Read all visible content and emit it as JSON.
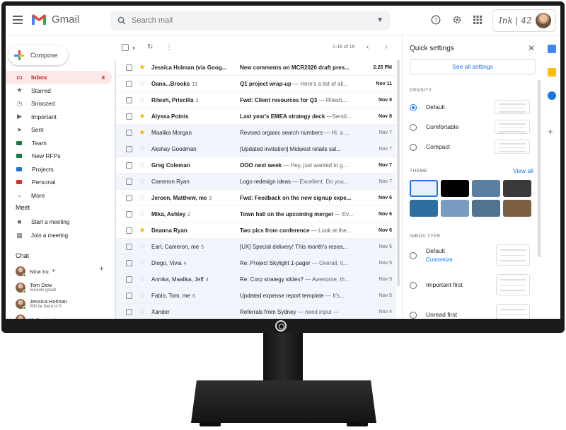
{
  "colors": {
    "accent_blue": "#1a73e8",
    "inbox_red": "#c5221f",
    "star_gold": "#f4b400",
    "bezel": "#1b1b1b"
  },
  "header": {
    "app_name": "Gmail",
    "search_placeholder": "Search mail",
    "account_brand": "Ink | 42",
    "icons": [
      "help-icon",
      "gear-icon",
      "apps-grid-icon"
    ]
  },
  "sidebar": {
    "compose_label": "Compose",
    "items": [
      {
        "label": "Inbox",
        "count": "8",
        "icon": "inbox-icon",
        "glyph": "▭",
        "active": true
      },
      {
        "label": "Starred",
        "count": "",
        "icon": "star-icon",
        "glyph": "★"
      },
      {
        "label": "Snoozed",
        "count": "",
        "icon": "clock-icon",
        "glyph": "◷"
      },
      {
        "label": "Important",
        "count": "",
        "icon": "important-icon",
        "glyph": "▶"
      },
      {
        "label": "Sent",
        "count": "",
        "icon": "send-icon",
        "glyph": "➤"
      },
      {
        "label": "Team",
        "count": "",
        "label_color": "#0b8043"
      },
      {
        "label": "New RFPs",
        "count": "",
        "label_color": "#0b8043"
      },
      {
        "label": "Projects",
        "count": "",
        "label_color": "#1a73e8"
      },
      {
        "label": "Personal",
        "count": "",
        "label_color": "#d93025"
      },
      {
        "label": "More",
        "count": "",
        "icon": "chevron-down-icon",
        "glyph": "⌄"
      }
    ],
    "meet_title": "Meet",
    "meet_items": [
      {
        "label": "Start a meeting",
        "icon": "video-icon",
        "glyph": "■"
      },
      {
        "label": "Join a meeting",
        "icon": "keyboard-icon",
        "glyph": "▦"
      }
    ],
    "chat_title": "Chat",
    "chat_self": "Nina Xu",
    "chat_users": [
      {
        "name": "Tom Dow",
        "status": "Sounds great!"
      },
      {
        "name": "Jessica Holman",
        "status": "Will be there in 5"
      },
      {
        "name": "Katherine Leaver",
        "status": ""
      }
    ]
  },
  "toolbar": {
    "pager": "1-16 of 16"
  },
  "emails": [
    {
      "sender": "Jessica Holman (via Goog...",
      "count": "",
      "subject": "New comments on MCR2020 draft pres...",
      "snippet": "",
      "date": "2:25 PM",
      "starred": true,
      "unread": true
    },
    {
      "sender": "Oana...Brooks",
      "count": "13",
      "subject": "Q1 project wrap-up",
      "snippet": " — Here's a list of all...",
      "date": "Nov 11",
      "starred": false,
      "unread": true
    },
    {
      "sender": "Ritesh, Priscilla",
      "count": "2",
      "subject": "Fwd: Client resources for Q3",
      "snippet": " — Ritesh,...",
      "date": "Nov 8",
      "starred": false,
      "unread": true
    },
    {
      "sender": "Alyssa Potnis",
      "count": "",
      "subject": "Last year's EMEA strategy deck",
      "snippet": " —Sendi...",
      "date": "Nov 8",
      "starred": true,
      "unread": true
    },
    {
      "sender": "Maalika Morgan",
      "count": "",
      "subject": "Revised organic search numbers",
      "snippet": " — Hi, a ...",
      "date": "Nov 7",
      "starred": true,
      "unread": false
    },
    {
      "sender": "Akshay Goodman",
      "count": "",
      "subject": "[Updated invitation] Midwest retails sal...",
      "snippet": "",
      "date": "Nov 7",
      "starred": false,
      "unread": false
    },
    {
      "sender": "Greg Coleman",
      "count": "",
      "subject": "OOO next week",
      "snippet": " — Hey, just wanted to g...",
      "date": "Nov 7",
      "starred": false,
      "unread": true
    },
    {
      "sender": "Cameron Ryan",
      "count": "",
      "subject": "Logo redesign ideas",
      "snippet": " — Excellent. Do you...",
      "date": "Nov 7",
      "starred": false,
      "unread": false
    },
    {
      "sender": "Jeroen, Matthew, me",
      "count": "3",
      "subject": "Fwd: Feedback on the new signup expe...",
      "snippet": "",
      "date": "Nov 6",
      "starred": false,
      "unread": true
    },
    {
      "sender": "Mika, Ashley",
      "count": "2",
      "subject": "Town hall on the upcoming merger",
      "snippet": " — Ev...",
      "date": "Nov 6",
      "starred": false,
      "unread": true
    },
    {
      "sender": "Deanna Ryan",
      "count": "",
      "subject": "Two pics from conference",
      "snippet": " — Look at the...",
      "date": "Nov 6",
      "starred": true,
      "unread": true
    },
    {
      "sender": "Earl, Cameron, me",
      "count": "5",
      "subject": "[UX] Special delivery! This month's resea...",
      "snippet": "",
      "date": "Nov 5",
      "starred": false,
      "unread": false
    },
    {
      "sender": "Diogo, Vivia",
      "count": "4",
      "subject": "Re: Project Skylight 1-pager",
      "snippet": " — Overall, it...",
      "date": "Nov 5",
      "starred": false,
      "unread": false
    },
    {
      "sender": "Annika, Maalika, Jeff",
      "count": "3",
      "subject": "Re: Corp strategy slides?",
      "snippet": " — Awesome, th...",
      "date": "Nov 5",
      "starred": false,
      "unread": false
    },
    {
      "sender": "Fabio, Tom, me",
      "count": "6",
      "subject": "Updated expense report template",
      "snippet": " — It's...",
      "date": "Nov 5",
      "starred": false,
      "unread": false
    },
    {
      "sender": "Xander",
      "count": "",
      "subject": "Referrals from Sydney",
      "snippet": " — need input —",
      "date": "Nov 4",
      "starred": false,
      "unread": false
    }
  ],
  "quick_settings": {
    "title": "Quick settings",
    "see_all": "See all settings",
    "density_title": "DENSITY",
    "density_options": [
      {
        "label": "Default",
        "selected": true
      },
      {
        "label": "Comfortable",
        "selected": false
      },
      {
        "label": "Compact",
        "selected": false
      }
    ],
    "theme_title": "THEME",
    "theme_link": "View all",
    "theme_tiles": [
      {
        "name": "theme-default",
        "color": "#e8f0fe"
      },
      {
        "name": "theme-dark",
        "color": "#000000"
      },
      {
        "name": "theme-landscape",
        "color": "#5b7fa0"
      },
      {
        "name": "theme-texture",
        "color": "#3a3a3a"
      },
      {
        "name": "theme-sea",
        "color": "#2c6ea0"
      },
      {
        "name": "theme-mountain",
        "color": "#7a9cc0"
      },
      {
        "name": "theme-lake",
        "color": "#4f7390"
      },
      {
        "name": "theme-sunset",
        "color": "#7c6040"
      }
    ],
    "inbox_type_title": "INBOX TYPE",
    "inbox_types": [
      {
        "label": "Default",
        "selected": false
      },
      {
        "label": "Important first",
        "selected": false
      },
      {
        "label": "Unread first",
        "selected": false
      }
    ],
    "customize": "Customize"
  },
  "right_rail": [
    {
      "name": "calendar-icon",
      "color": "#4285f4"
    },
    {
      "name": "keep-icon",
      "color": "#fbbc04"
    },
    {
      "name": "tasks-icon",
      "color": "#1a73e8"
    }
  ]
}
